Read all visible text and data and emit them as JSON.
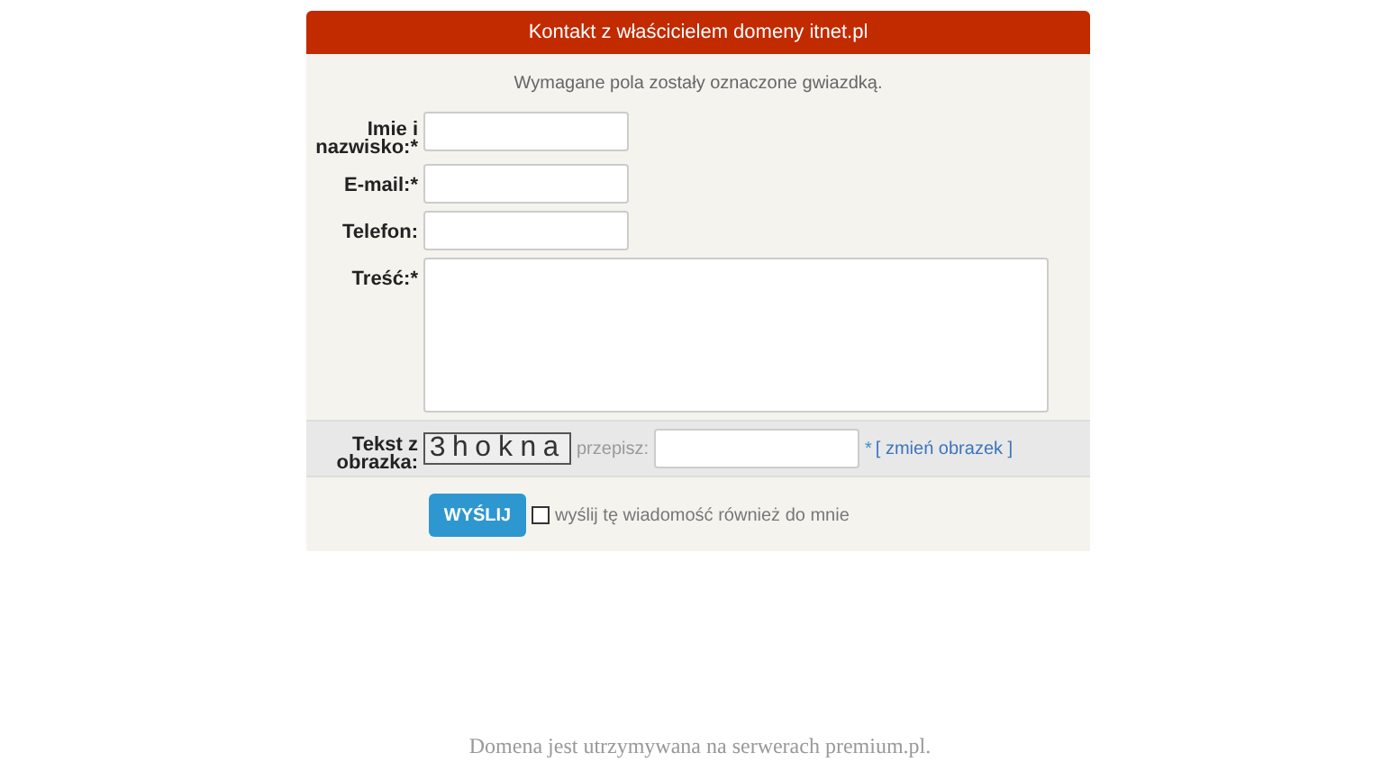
{
  "header": {
    "title": "Kontakt z właścicielem domeny itnet.pl"
  },
  "note": "Wymagane pola zostały oznaczone gwiazdką.",
  "fields": [
    {
      "kind": "input",
      "label": "Imie i nazwisko:",
      "required_mark": "*"
    },
    {
      "kind": "input",
      "label": "E-mail:",
      "required_mark": "*"
    },
    {
      "kind": "input",
      "label": "Telefon:"
    },
    {
      "kind": "textarea",
      "label": "Treść:",
      "required_mark": "*"
    }
  ],
  "captcha": {
    "label": "Tekst z obrazka:",
    "image_text": "3hokna",
    "hint": "przepisz:",
    "required_mark": "*",
    "link": "[ zmień obrazek ]"
  },
  "submit": {
    "label": "WYŚLIJ"
  },
  "copy_option": {
    "label": "wyślij tę wiadomość również do mnie",
    "checked": false
  },
  "footer": "Domena jest utrzymywana na serwerach premium.pl."
}
